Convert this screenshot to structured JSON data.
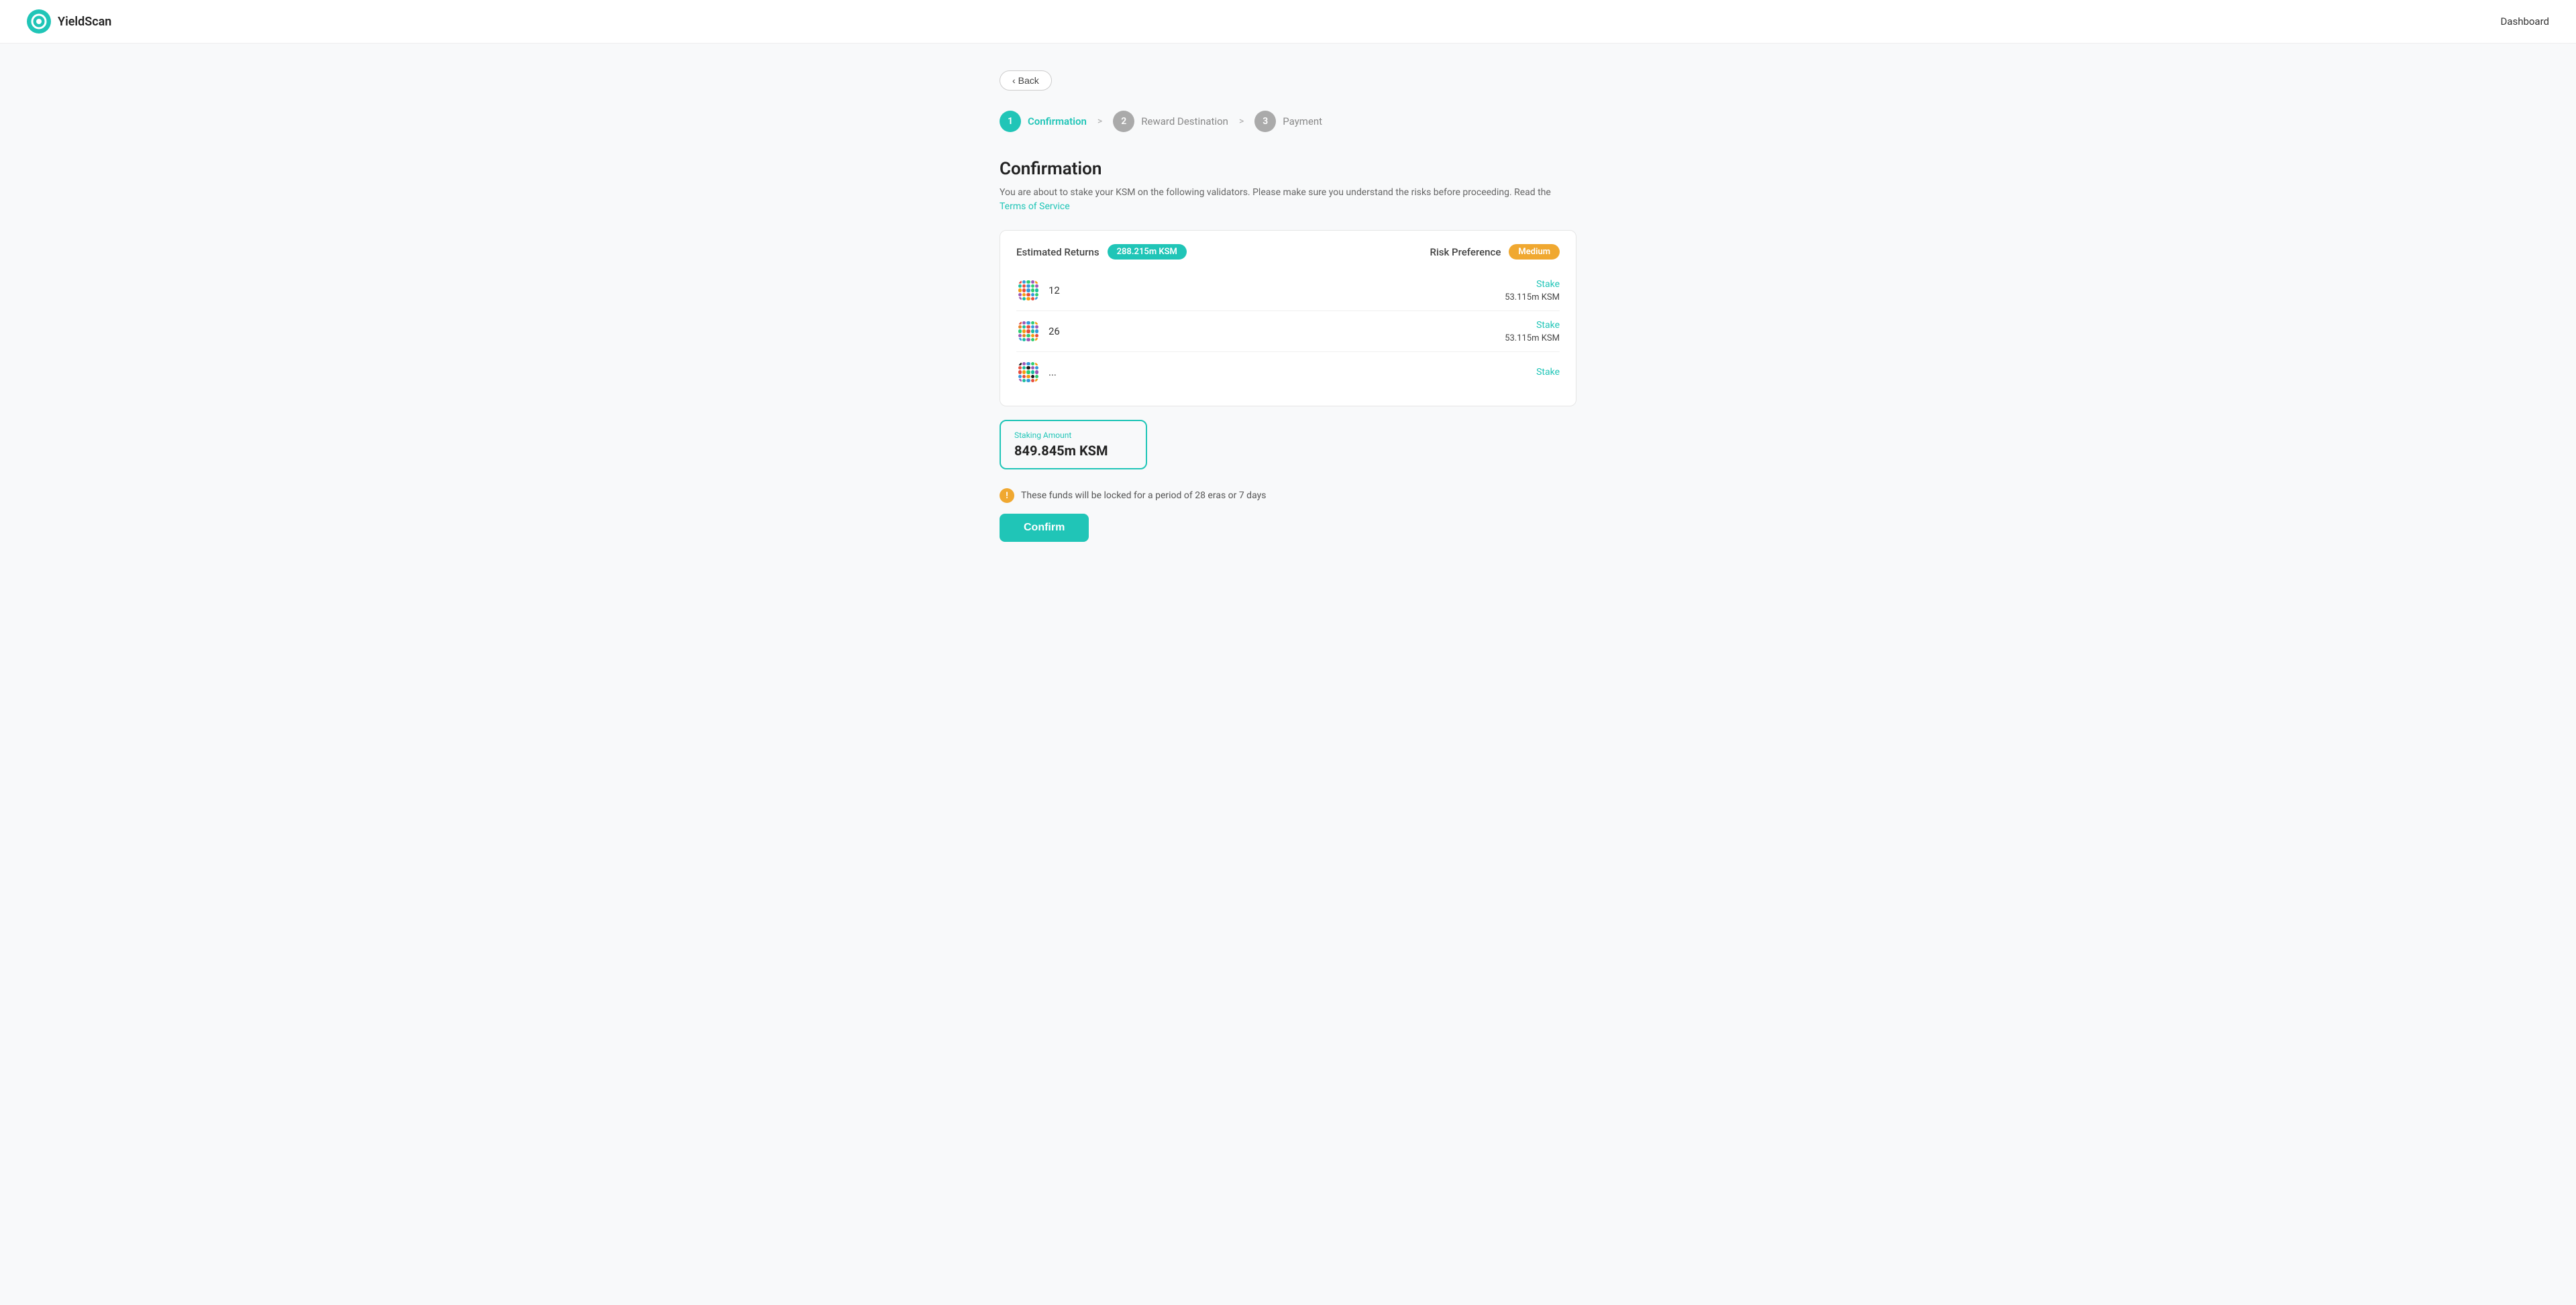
{
  "header": {
    "logo_text": "YieldScan",
    "dashboard_link": "Dashboard"
  },
  "back_button": {
    "label": "Back"
  },
  "stepper": {
    "steps": [
      {
        "number": "1",
        "label": "Confirmation",
        "state": "active"
      },
      {
        "number": "2",
        "label": "Reward Destination",
        "state": "inactive"
      },
      {
        "number": "3",
        "label": "Payment",
        "state": "inactive"
      }
    ]
  },
  "page": {
    "title": "Confirmation",
    "description": "You are about to stake your KSM on the following validators. Please make sure you understand the risks before proceeding. Read the",
    "terms_link": "Terms of Service"
  },
  "card": {
    "estimated_returns_label": "Estimated Returns",
    "estimated_returns_value": "288.215m KSM",
    "risk_preference_label": "Risk Preference",
    "risk_preference_value": "Medium",
    "validators": [
      {
        "id": "v1",
        "name": "12",
        "stake_label": "Stake",
        "stake_amount": "53.115m KSM"
      },
      {
        "id": "v2",
        "name": "26",
        "stake_label": "Stake",
        "stake_amount": "53.115m KSM"
      },
      {
        "id": "v3",
        "name": "...",
        "stake_label": "Stake",
        "stake_amount": ""
      }
    ]
  },
  "staking": {
    "label": "Staking Amount",
    "value": "849.845m KSM"
  },
  "warning": {
    "text": "These funds will be locked for a period of 28 eras or 7 days"
  },
  "confirm_button": {
    "label": "Confirm"
  },
  "colors": {
    "teal": "#20c5b7",
    "orange": "#f0a830",
    "inactive_step": "#aaa"
  }
}
